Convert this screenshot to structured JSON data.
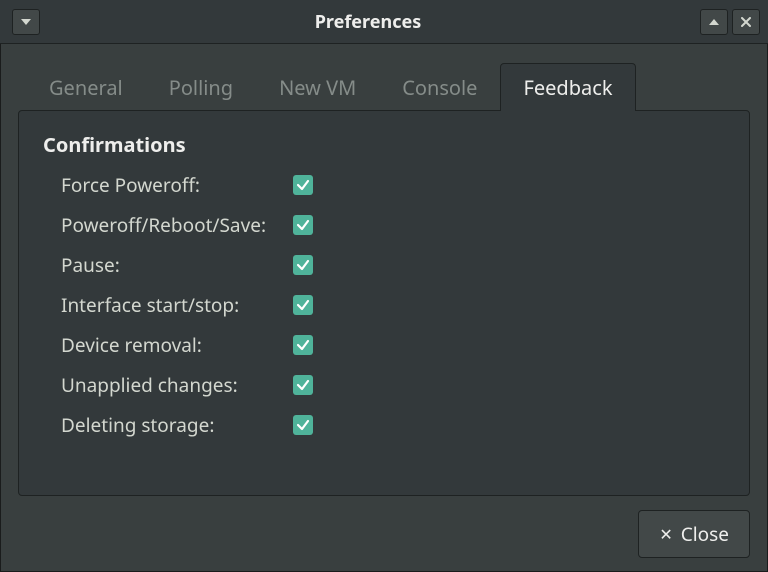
{
  "window": {
    "title": "Preferences"
  },
  "tabs": [
    {
      "label": "General"
    },
    {
      "label": "Polling"
    },
    {
      "label": "New VM"
    },
    {
      "label": "Console"
    },
    {
      "label": "Feedback"
    }
  ],
  "active_tab_index": 4,
  "feedback": {
    "section_title": "Confirmations",
    "items": [
      {
        "label": "Force Poweroff:",
        "checked": true
      },
      {
        "label": "Poweroff/Reboot/Save:",
        "checked": true
      },
      {
        "label": "Pause:",
        "checked": true
      },
      {
        "label": "Interface start/stop:",
        "checked": true
      },
      {
        "label": "Device removal:",
        "checked": true
      },
      {
        "label": "Unapplied changes:",
        "checked": true
      },
      {
        "label": "Deleting storage:",
        "checked": true
      }
    ]
  },
  "buttons": {
    "close": "Close"
  },
  "colors": {
    "accent": "#4fb39a",
    "panel": "#33393b",
    "window": "#393f3f",
    "border": "#1e2222"
  }
}
